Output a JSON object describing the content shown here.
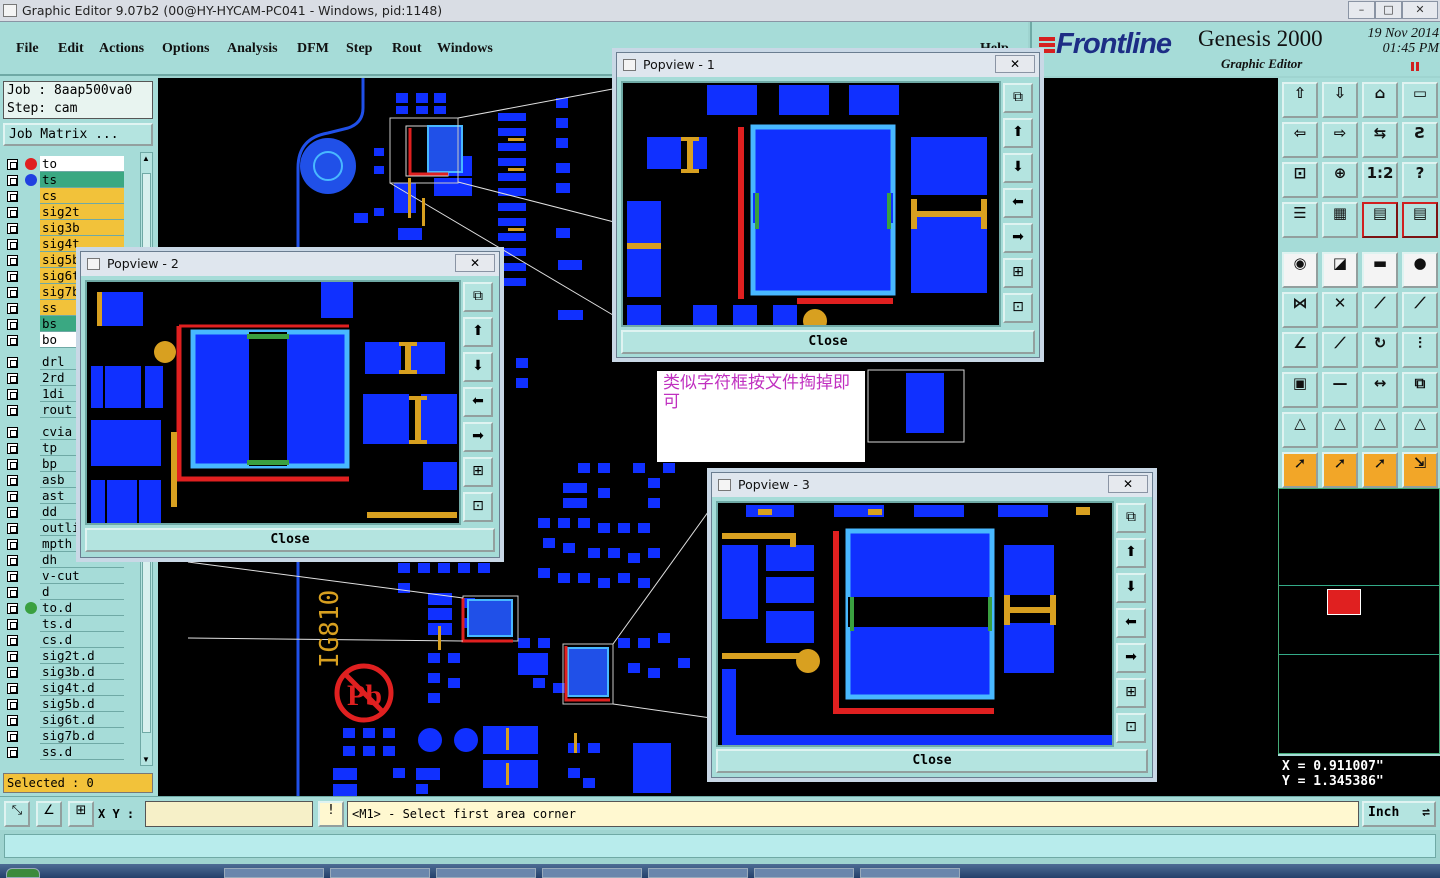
{
  "window": {
    "title": "Graphic Editor 9.07b2 (00@HY-HYCAM-PC041 - Windows, pid:1148)",
    "minimize": "–",
    "maximize": "□",
    "close": "✕"
  },
  "menu": [
    "File",
    "Edit",
    "Actions",
    "Options",
    "Analysis",
    "DFM",
    "Step",
    "Rout",
    "Windows"
  ],
  "help": "Help",
  "brand": {
    "logo": "Frontline",
    "product": "Genesis 2000",
    "subtitle": "Graphic Editor",
    "date": "19 Nov 2014",
    "time": "01:45 PM"
  },
  "job": {
    "job_line": "Job : 8aap500va0",
    "step_line": "Step: cam",
    "matrix_button": "Job Matrix ..."
  },
  "layers": [
    {
      "name": "to",
      "style": "wht",
      "dot": "#e02020"
    },
    {
      "name": "ts",
      "style": "ts",
      "dot": "#2040e0"
    },
    {
      "name": "cs",
      "style": "sig",
      "dot": ""
    },
    {
      "name": "sig2t",
      "style": "sig",
      "dot": ""
    },
    {
      "name": "sig3b",
      "style": "sig",
      "dot": ""
    },
    {
      "name": "sig4t",
      "style": "sig",
      "dot": ""
    },
    {
      "name": "sig5b",
      "style": "sig",
      "dot": ""
    },
    {
      "name": "sig6t",
      "style": "sig",
      "dot": ""
    },
    {
      "name": "sig7b",
      "style": "sig",
      "dot": ""
    },
    {
      "name": "ss",
      "style": "sig",
      "dot": ""
    },
    {
      "name": "bs",
      "style": "bs",
      "dot": ""
    },
    {
      "name": "bo",
      "style": "wht",
      "dot": ""
    },
    {
      "name": "drl",
      "style": "plain",
      "dot": ""
    },
    {
      "name": "2rd",
      "style": "plain",
      "dot": ""
    },
    {
      "name": "1di",
      "style": "plain",
      "dot": ""
    },
    {
      "name": "rout",
      "style": "plain",
      "dot": ""
    },
    {
      "name": "cvia",
      "style": "plain",
      "dot": ""
    },
    {
      "name": "tp",
      "style": "plain",
      "dot": ""
    },
    {
      "name": "bp",
      "style": "plain",
      "dot": ""
    },
    {
      "name": "asb",
      "style": "plain",
      "dot": ""
    },
    {
      "name": "ast",
      "style": "plain",
      "dot": ""
    },
    {
      "name": "dd",
      "style": "plain",
      "dot": ""
    },
    {
      "name": "outli",
      "style": "plain",
      "dot": ""
    },
    {
      "name": "mpth",
      "style": "plain",
      "dot": ""
    },
    {
      "name": "dh",
      "style": "plain",
      "dot": ""
    },
    {
      "name": "v-cut",
      "style": "plain",
      "dot": ""
    },
    {
      "name": "d",
      "style": "plain",
      "dot": ""
    },
    {
      "name": "to.d",
      "style": "plain",
      "dot": "#3aa040"
    },
    {
      "name": "ts.d",
      "style": "plain",
      "dot": ""
    },
    {
      "name": "cs.d",
      "style": "plain",
      "dot": ""
    },
    {
      "name": "sig2t.d",
      "style": "plain",
      "dot": ""
    },
    {
      "name": "sig3b.d",
      "style": "plain",
      "dot": ""
    },
    {
      "name": "sig4t.d",
      "style": "plain",
      "dot": ""
    },
    {
      "name": "sig5b.d",
      "style": "plain",
      "dot": ""
    },
    {
      "name": "sig6t.d",
      "style": "plain",
      "dot": ""
    },
    {
      "name": "sig7b.d",
      "style": "plain",
      "dot": ""
    },
    {
      "name": "ss.d",
      "style": "plain",
      "dot": ""
    }
  ],
  "selected": "Selected : 0",
  "popviews": [
    {
      "title": "Popview - 1",
      "close_label": "Close",
      "x_label": "✕"
    },
    {
      "title": "Popview - 2",
      "close_label": "Close",
      "x_label": "✕"
    },
    {
      "title": "Popview - 3",
      "close_label": "Close",
      "x_label": "✕"
    }
  ],
  "note": "类似字符框按文件掏掉即可",
  "board_text": "IG810",
  "coords": {
    "x": "X = 0.911007\"",
    "y": "Y = 1.345386\""
  },
  "status": {
    "xy_label": "X Y :",
    "message": "<M1> - Select first area corner",
    "unit": "Inch"
  },
  "tools": [
    {
      "icon": "⇧",
      "style": ""
    },
    {
      "icon": "⇩",
      "style": ""
    },
    {
      "icon": "⌂",
      "style": ""
    },
    {
      "icon": "▭",
      "style": ""
    },
    {
      "icon": "⇦",
      "style": ""
    },
    {
      "icon": "⇨",
      "style": ""
    },
    {
      "icon": "⇆",
      "style": ""
    },
    {
      "icon": "Ƨ",
      "style": ""
    },
    {
      "icon": "⊡",
      "style": ""
    },
    {
      "icon": "⊕",
      "style": ""
    },
    {
      "icon": "1:2",
      "style": ""
    },
    {
      "icon": "?",
      "style": ""
    },
    {
      "icon": "☰",
      "style": ""
    },
    {
      "icon": "▦",
      "style": ""
    },
    {
      "icon": "▤",
      "style": "red"
    },
    {
      "icon": "▤",
      "style": "red"
    },
    {
      "icon": "◉",
      "style": "wht"
    },
    {
      "icon": "◪",
      "style": "wht"
    },
    {
      "icon": "▬",
      "style": "wht"
    },
    {
      "icon": "●",
      "style": "wht"
    },
    {
      "icon": "⋈",
      "style": ""
    },
    {
      "icon": "✕",
      "style": ""
    },
    {
      "icon": "⟋",
      "style": ""
    },
    {
      "icon": "⟋",
      "style": ""
    },
    {
      "icon": "∠",
      "style": ""
    },
    {
      "icon": "⟋",
      "style": ""
    },
    {
      "icon": "↻",
      "style": ""
    },
    {
      "icon": "⫶",
      "style": ""
    },
    {
      "icon": "▣",
      "style": ""
    },
    {
      "icon": "—",
      "style": ""
    },
    {
      "icon": "↔",
      "style": ""
    },
    {
      "icon": "⧉",
      "style": ""
    },
    {
      "icon": "△",
      "style": ""
    },
    {
      "icon": "△",
      "style": ""
    },
    {
      "icon": "△",
      "style": ""
    },
    {
      "icon": "△",
      "style": ""
    },
    {
      "icon": "➚",
      "style": "ora"
    },
    {
      "icon": "➚",
      "style": "ora"
    },
    {
      "icon": "➚",
      "style": "ora"
    },
    {
      "icon": "⇲",
      "style": "ora"
    }
  ]
}
